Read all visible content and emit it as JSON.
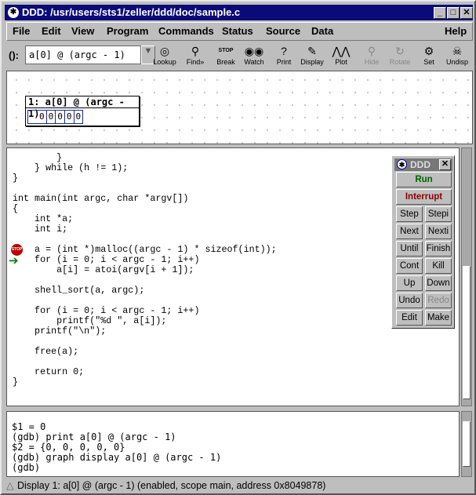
{
  "window": {
    "title": "DDD: /usr/users/sts1/zeller/ddd/doc/sample.c",
    "minimize": "_",
    "maximize": "□",
    "close": "✕"
  },
  "menus": [
    "File",
    "Edit",
    "View",
    "Program",
    "Commands",
    "Status",
    "Source",
    "Data",
    "Help"
  ],
  "toolbar": {
    "arg_label": "():",
    "arg_value": "a[0] @ (argc - 1)",
    "buttons": [
      {
        "label": "Lookup",
        "icon": "◎"
      },
      {
        "label": "Find»",
        "icon": "⚲"
      },
      {
        "label": "Break",
        "icon": "STOP"
      },
      {
        "label": "Watch",
        "icon": "◉◉"
      },
      {
        "label": "Print",
        "icon": "?"
      },
      {
        "label": "Display",
        "icon": "✎"
      },
      {
        "label": "Plot",
        "icon": "⋀⋀"
      },
      {
        "label": "Hide",
        "icon": "⚲",
        "disabled": true
      },
      {
        "label": "Rotate",
        "icon": "↻",
        "disabled": true
      },
      {
        "label": "Set",
        "icon": "⚙"
      },
      {
        "label": "Undisp",
        "icon": "☠"
      }
    ]
  },
  "graph": {
    "display_title": "1: a[0] @ (argc - 1)",
    "values": [
      "0",
      "0",
      "0",
      "0",
      "0"
    ]
  },
  "source": {
    "lines": [
      "        }",
      "    } while (h != 1);",
      "}",
      "",
      "int main(int argc, char *argv[])",
      "{",
      "    int *a;",
      "    int i;",
      "",
      "    a = (int *)malloc((argc - 1) * sizeof(int));",
      "    for (i = 0; i < argc - 1; i++)",
      "        a[i] = atoi(argv[i + 1]);",
      "",
      "    shell_sort(a, argc);",
      "",
      "    for (i = 0; i < argc - 1; i++)",
      "        printf(\"%d \", a[i]);",
      "    printf(\"\\n\");",
      "",
      "    free(a);",
      "",
      "    return 0;",
      "}"
    ],
    "breakpoint_icon": "STOP",
    "exec_arrow": "➔"
  },
  "palette": {
    "title": "DDD",
    "close": "✕",
    "run": "Run",
    "interrupt": "Interrupt",
    "run_color": "#006400",
    "interrupt_color": "#8b0000",
    "buttons": [
      "Step",
      "Stepi",
      "Next",
      "Nexti",
      "Until",
      "Finish",
      "Cont",
      "Kill",
      "Up",
      "Down",
      "Undo",
      "Redo",
      "Edit",
      "Make"
    ]
  },
  "console": {
    "lines": [
      "$1 = 0",
      "(gdb) print a[0] @ (argc - 1)",
      "$2 = {0, 0, 0, 0, 0}",
      "(gdb) graph display a[0] @ (argc - 1)",
      "(gdb) "
    ]
  },
  "status": {
    "text": "Display 1: a[0] @ (argc - 1) (enabled, scope main, address 0x8049878)"
  }
}
